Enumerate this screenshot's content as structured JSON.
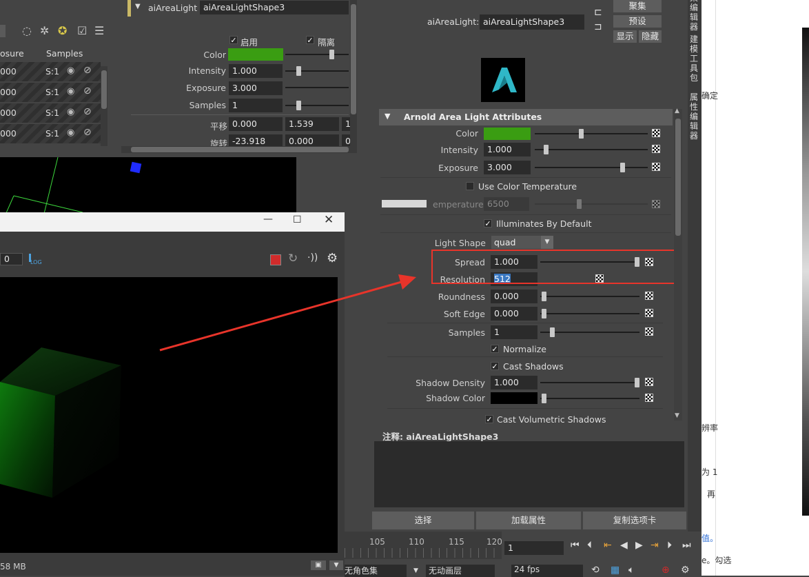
{
  "left_panel": {
    "headers": [
      "osure",
      "Samples"
    ],
    "rows": [
      {
        "val": "000",
        "samples": "S:1"
      },
      {
        "val": "000",
        "samples": "S:1"
      },
      {
        "val": "000",
        "samples": "S:1"
      },
      {
        "val": "000",
        "samples": "S:1"
      }
    ]
  },
  "mini_editor": {
    "node_type": "aiAreaLight",
    "node_name": "aiAreaLightShape3",
    "enable_label": "启用",
    "isolate_label": "隔离",
    "color_label": "Color",
    "intensity_label": "Intensity",
    "intensity": "1.000",
    "exposure_label": "Exposure",
    "exposure": "3.000",
    "samples_label": "Samples",
    "samples": "1",
    "translate_label": "平移",
    "translate": [
      "0.000",
      "1.539",
      "1"
    ],
    "rotate_label": "旋转",
    "rotate": [
      "-23.918",
      "0.000",
      "0"
    ]
  },
  "render_window": {
    "frame_value": "0",
    "log_label": "LOG",
    "memory": "58 MB"
  },
  "attribute_editor": {
    "node_type_label": "aiAreaLight:",
    "node_name": "aiAreaLightShape3",
    "buttons": {
      "focus": "聚集",
      "presets": "预设",
      "show": "显示",
      "hide": "隐藏"
    },
    "section_title": "Arnold Area Light Attributes",
    "attrs": {
      "color_label": "Color",
      "intensity_label": "Intensity",
      "intensity": "1.000",
      "exposure_label": "Exposure",
      "exposure": "3.000",
      "use_color_temp_label": "Use Color Temperature",
      "temperature_label": "emperature",
      "temperature": "6500",
      "illuminates_label": "Illuminates By Default",
      "light_shape_label": "Light Shape",
      "light_shape": "quad",
      "spread_label": "Spread",
      "spread": "1.000",
      "resolution_label": "Resolution",
      "resolution": "512",
      "roundness_label": "Roundness",
      "roundness": "0.000",
      "soft_edge_label": "Soft Edge",
      "soft_edge": "0.000",
      "samples_label": "Samples",
      "samples": "1",
      "normalize_label": "Normalize",
      "cast_shadows_label": "Cast Shadows",
      "shadow_density_label": "Shadow Density",
      "shadow_density": "1.000",
      "shadow_color_label": "Shadow Color",
      "cast_vol_shadows_label": "Cast Volumetric Shadows"
    },
    "notes_label": "注释:",
    "notes_node": "aiAreaLightShape3",
    "bottom_buttons": {
      "select": "选择",
      "load": "加载属性",
      "copy_tab": "复制选项卡"
    }
  },
  "timeline": {
    "ticks": [
      "105",
      "110",
      "115",
      "120"
    ],
    "current_frame": "1",
    "fps": "24 fps",
    "char_set": "无角色集",
    "anim_layer": "无动画层"
  },
  "side_tabs": [
    "渲染编辑器",
    "建模工具包",
    "属性编辑器"
  ],
  "doc_fragments": [
    "确定",
    "辨率",
    "为 1",
    "再",
    "值。",
    "e。勾选"
  ],
  "colors": {
    "light_color": "#3a9d12",
    "highlight": "#e8342a",
    "accent_bar": "#c9b866"
  }
}
